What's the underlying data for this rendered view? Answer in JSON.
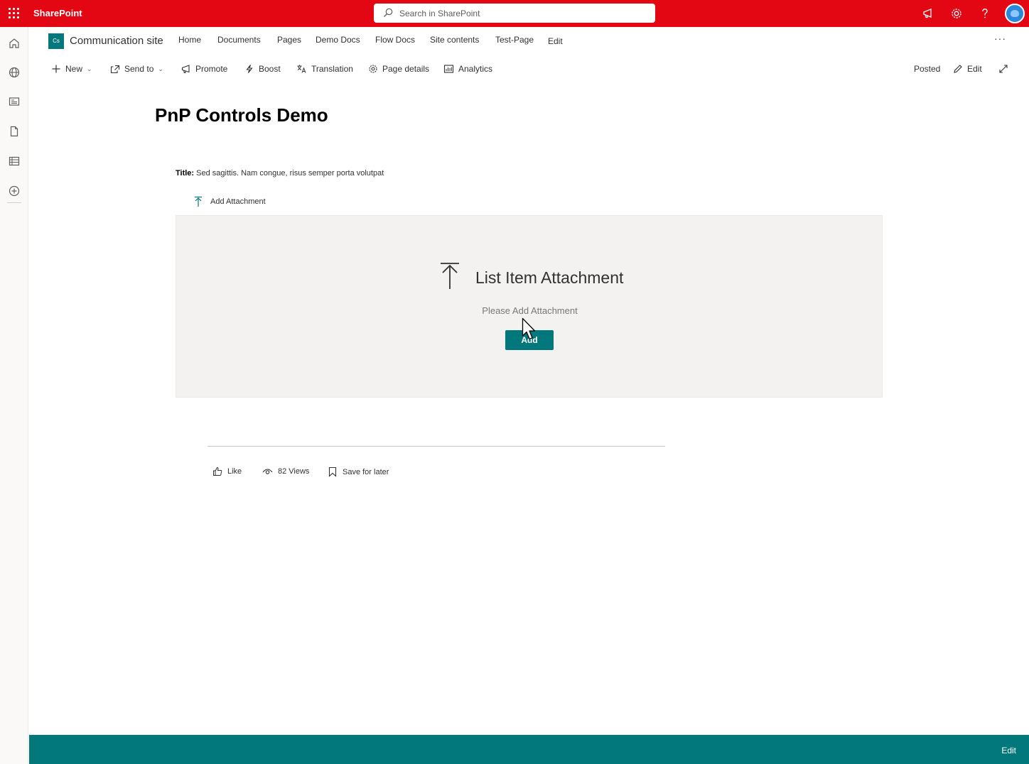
{
  "suite_bar": {
    "app_name": "SharePoint",
    "search_placeholder": "Search in SharePoint",
    "icons": [
      "waffle-icon",
      "megaphone-icon",
      "gear-icon",
      "help-icon",
      "avatar"
    ],
    "color": "#e30613"
  },
  "left_rail": {
    "icons": [
      "home-icon",
      "globe-icon",
      "news-icon",
      "file-icon",
      "list-icon",
      "add-circle-icon"
    ]
  },
  "site_header": {
    "logo_text": "Cs",
    "site_title": "Communication site",
    "nav": [
      "Home",
      "Documents",
      "Pages",
      "Demo Docs",
      "Flow Docs",
      "Site contents",
      "Test-Page",
      "Edit"
    ],
    "more_label": "···"
  },
  "command_bar": {
    "new": "New",
    "send_to": "Send to",
    "promote": "Promote",
    "boost": "Boost",
    "translation": "Translation",
    "page_details": "Page details",
    "analytics": "Analytics",
    "posted": "Posted",
    "edit": "Edit"
  },
  "page": {
    "title": "PnP Controls Demo",
    "item_title_label": "Title:",
    "item_title_value": "Sed sagittis. Nam congue, risus semper porta volutpat",
    "add_attachment_link": "Add Attachment"
  },
  "attachment_panel": {
    "heading": "List Item Attachment",
    "subtext": "Please Add Attachment",
    "add_button": "Add"
  },
  "social_bar": {
    "like": "Like",
    "views": "82 Views",
    "save_for_later": "Save for later"
  },
  "footer": {
    "edit": "Edit",
    "color": "#03787c"
  }
}
